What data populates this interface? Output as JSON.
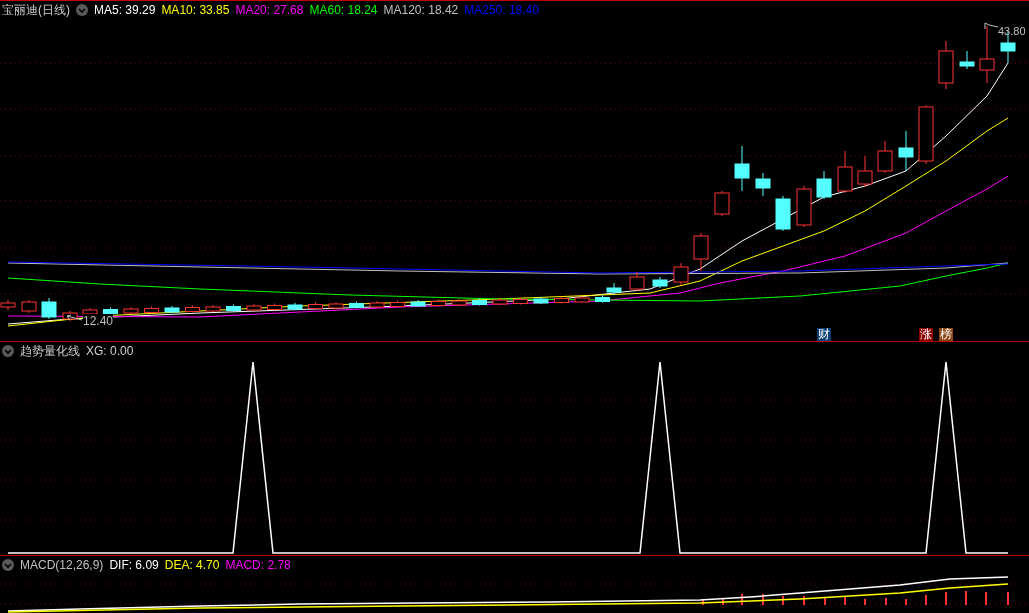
{
  "title": "宝丽迪(日线)",
  "ma_readings": [
    {
      "label": "MA5: 39.29",
      "color": "#ffffff"
    },
    {
      "label": "MA10: 33.85",
      "color": "#ffff00"
    },
    {
      "label": "MA20: 27.68",
      "color": "#ff00ff"
    },
    {
      "label": "MA60: 18.24",
      "color": "#00ff00"
    },
    {
      "label": "MA120: 18.42",
      "color": "#c0c0c0"
    },
    {
      "label": "MA250: 18.40",
      "color": "#0000ff"
    }
  ],
  "high_label": "43.80",
  "low_label": "12.40",
  "badges": [
    {
      "text": "财",
      "color": "#0b3d72"
    },
    {
      "text": "涨",
      "color": "#8b0000"
    },
    {
      "text": "榜",
      "color": "#8b4513"
    }
  ],
  "indicator": {
    "title": "趋势量化线",
    "reading": "XG: 0.00"
  },
  "macd": {
    "title": "MACD(12,26,9)",
    "readings": [
      {
        "label": "DIF: 6.09",
        "color": "#ffffff"
      },
      {
        "label": "DEA: 4.70",
        "color": "#ffff00"
      },
      {
        "label": "MACD: 2.78",
        "color": "#ff00ff"
      }
    ]
  }
}
